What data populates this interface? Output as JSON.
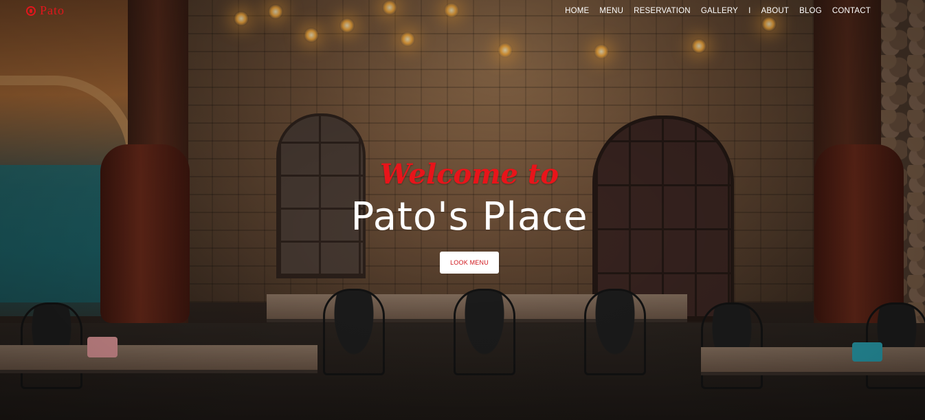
{
  "brand": {
    "logo_text": "Pato",
    "accent_color": "#e0161c"
  },
  "nav": {
    "items": [
      {
        "label": "HOME"
      },
      {
        "label": "MENU"
      },
      {
        "label": "RESERVATION"
      },
      {
        "label": "GALLERY"
      },
      {
        "label": "I"
      },
      {
        "label": "ABOUT"
      },
      {
        "label": "BLOG"
      },
      {
        "label": "CONTACT"
      }
    ]
  },
  "hero": {
    "welcome": "Welcome to",
    "title": "Pato's Place",
    "cta_label": "LOOK MENU",
    "background_description_icon": "restaurant-interior-photo"
  }
}
